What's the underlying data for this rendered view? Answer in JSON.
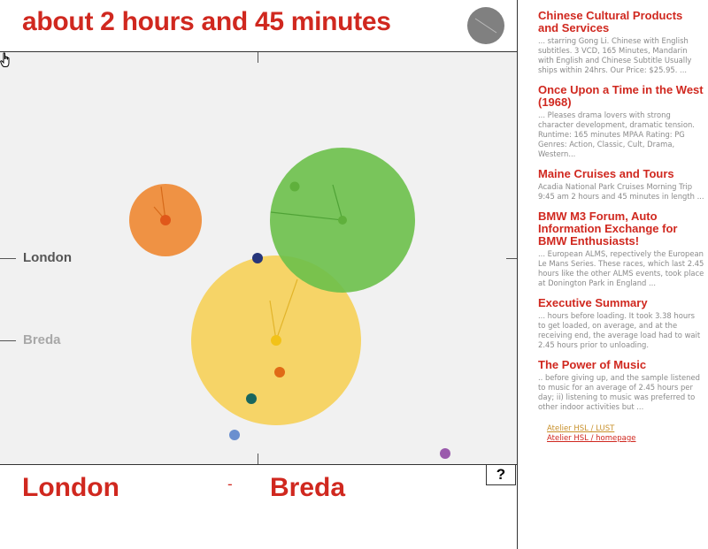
{
  "headline": "about 2 hours and 45 minutes",
  "viz": {
    "axis_labels": [
      "London",
      "Breda"
    ]
  },
  "footer": {
    "from": "London",
    "separator": "-",
    "to": "Breda",
    "help": "?"
  },
  "colors": {
    "accent": "#d0281f",
    "orange": "#ee8c3a",
    "green": "#6cc04a",
    "yellow": "#f6d25f",
    "clock": "#808080"
  },
  "icons": {
    "clock": "clock-icon",
    "cursor": "hand-pointer-icon",
    "help": "help-icon"
  },
  "results": [
    {
      "title": "Chinese Cultural Products and Services",
      "snippet": "... starring Gong Li. Chinese with English subtitles. 3 VCD, 165 Minutes, Mandarin with English and Chinese Subtitle Usually ships within 24hrs. Our Price: $25.95. ..."
    },
    {
      "title": "Once Upon a Time in the West (1968)",
      "snippet": "... Pleases drama lovers with strong character development, dramatic tension. Runtime: 165 minutes MPAA Rating: PG Genres: Action, Classic, Cult, Drama, Western..."
    },
    {
      "title": "Maine Cruises and Tours",
      "snippet": "Acadia National Park Cruises Morning Trip 9:45 am 2 hours and 45 minutes in length ..."
    },
    {
      "title": "BMW M3 Forum, Auto Information Exchange for BMW Enthusiasts!",
      "snippet": "... European ALMS, repectively the European Le Mans Series. These races, which last 2.45 hours like the other ALMS events, took place at Donington Park in England ..."
    },
    {
      "title": "Executive Summary",
      "snippet": "... hours before loading. It took 3.38 hours to get loaded, on average, and at the receiving end, the average load had to wait 2.45 hours prior to unloading."
    },
    {
      "title": "The Power of Music",
      "snippet": ".. before giving up, and the sample listened to music for an average of 2.45 hours per day; ii) listening to music was preferred to other indoor activities but ..."
    }
  ],
  "links": [
    "Atelier HSL / LUST",
    "Atelier HSL / homepage"
  ]
}
